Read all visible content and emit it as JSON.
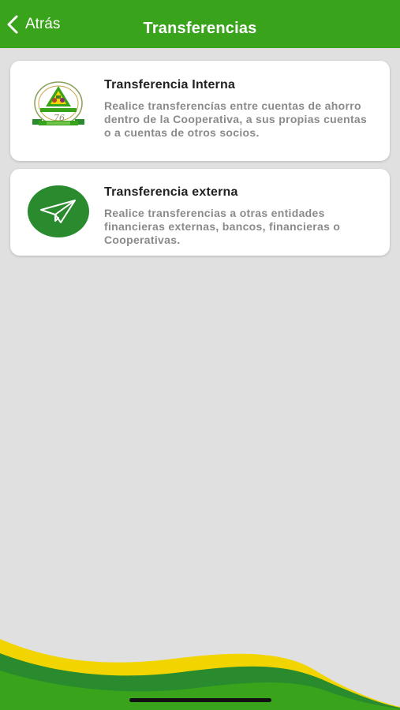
{
  "header": {
    "back_label": "Atrás",
    "title": "Transferencias"
  },
  "options": [
    {
      "title": "Transferencia Interna",
      "description": "Realice transferencías entre cuentas de ahorro dentro de la Cooperativa, a sus propias cuentas o a cuentas de otros socios.",
      "icon": "cooperative-logo-icon"
    },
    {
      "title": "Transferencia externa",
      "description": "Realice transferencias a otras entidades financieras externas, bancos, financieras o Cooperativas.",
      "icon": "paper-plane-icon"
    }
  ],
  "colors": {
    "brand_green": "#3aa31c",
    "dark_green": "#2a8a2e",
    "accent_yellow": "#f2d500",
    "background": "#e0e0e0"
  }
}
